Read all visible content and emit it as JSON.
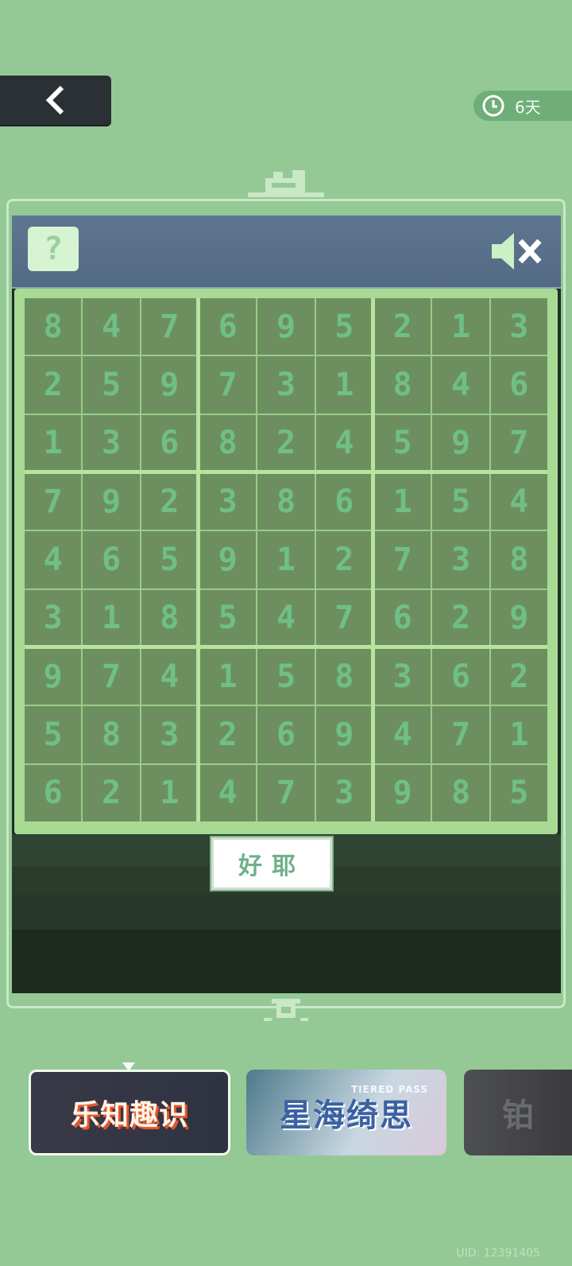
{
  "header": {
    "back_icon": "chevron-left-icon",
    "timer_icon": "clock-icon",
    "timer_text": "6天"
  },
  "panel": {
    "help_glyph": "?",
    "help_icon": "question-mark-icon",
    "sound_icon": "speaker-muted-icon"
  },
  "board": {
    "grid": [
      [
        "8",
        "4",
        "7",
        "6",
        "9",
        "5",
        "2",
        "1",
        "3"
      ],
      [
        "2",
        "5",
        "9",
        "7",
        "3",
        "1",
        "8",
        "4",
        "6"
      ],
      [
        "1",
        "3",
        "6",
        "8",
        "2",
        "4",
        "5",
        "9",
        "7"
      ],
      [
        "7",
        "9",
        "2",
        "3",
        "8",
        "6",
        "1",
        "5",
        "4"
      ],
      [
        "4",
        "6",
        "5",
        "9",
        "1",
        "2",
        "7",
        "3",
        "8"
      ],
      [
        "3",
        "1",
        "8",
        "5",
        "4",
        "7",
        "6",
        "2",
        "9"
      ],
      [
        "9",
        "7",
        "4",
        "1",
        "5",
        "8",
        "3",
        "6",
        "2"
      ],
      [
        "5",
        "8",
        "3",
        "2",
        "6",
        "9",
        "4",
        "7",
        "1"
      ],
      [
        "6",
        "2",
        "1",
        "4",
        "7",
        "3",
        "9",
        "8",
        "5"
      ]
    ]
  },
  "ok_button": "好耶",
  "cards": [
    {
      "title": "乐知趣识",
      "selected": true
    },
    {
      "title": "星海绮思",
      "subtitle": "TIERED PASS"
    },
    {
      "title": "铂"
    }
  ],
  "uid": "UID: 12391405",
  "colors": {
    "background": "#94c995",
    "digit": "#6fbf86",
    "box_line": "#b6e49e"
  }
}
